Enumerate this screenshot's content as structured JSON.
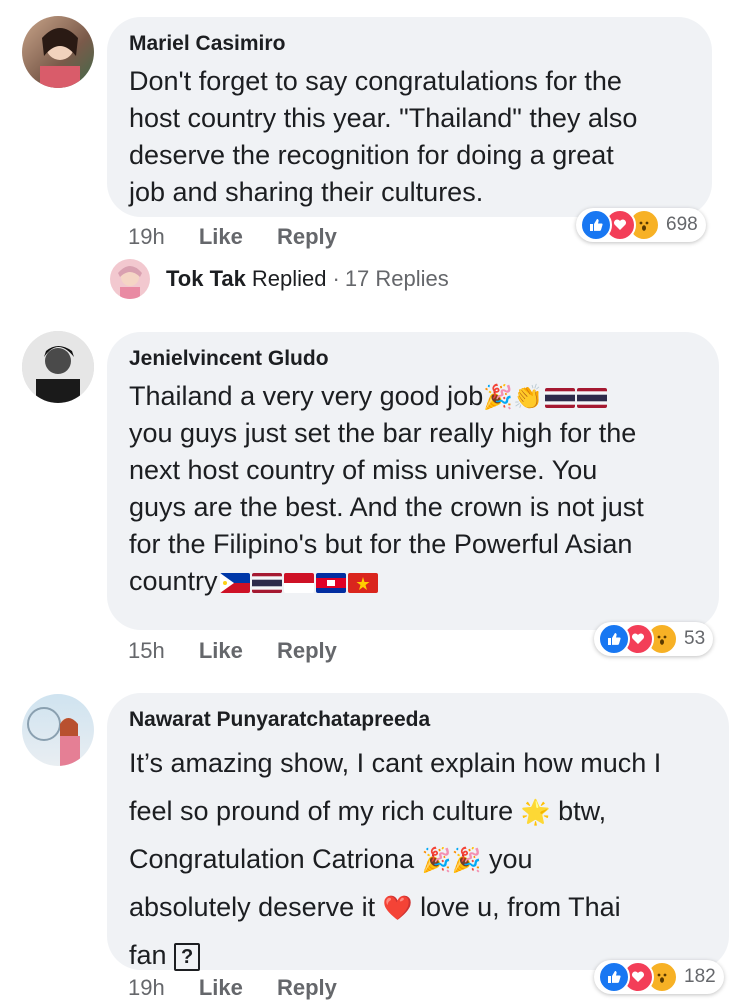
{
  "comments": [
    {
      "author": "Mariel Casimiro",
      "lines": [
        "Don't forget to say congratulations for the",
        "host country this year. \"Thailand\" they also",
        "deserve the recognition for doing a great",
        "job and sharing their cultures."
      ],
      "time": "19h",
      "like": "Like",
      "reply": "Reply",
      "reaction_count": "698",
      "replies": {
        "name": "Tok Tak",
        "verb": "Replied",
        "sep": "·",
        "count": "17 Replies"
      }
    },
    {
      "author": "Jenielvincent Gludo",
      "lines": [
        "Thailand a very very good job",
        "you guys just set the bar really high for the",
        "next host country of miss universe. You",
        "guys are the best. And the crown is not just",
        "for the Filipino's but for the Powerful Asian",
        "country"
      ],
      "time": "15h",
      "like": "Like",
      "reply": "Reply",
      "reaction_count": "53"
    },
    {
      "author": "Nawarat Punyaratchatapreeda",
      "lines": [
        "It’s amazing show, I cant explain how much I",
        "feel so pround of my rich culture",
        "btw,",
        "Congratulation Catriona",
        "you",
        "absolutely deserve it",
        "love u, from Thai",
        "fan"
      ],
      "time": "19h",
      "like": "Like",
      "reply": "Reply",
      "reaction_count": "182"
    }
  ],
  "icons": {
    "like": "like-reaction-icon",
    "love": "love-reaction-icon",
    "wow": "wow-reaction-icon",
    "party": "party-popper-icon",
    "clap": "clapping-hands-icon",
    "star": "glowing-star-icon",
    "heart": "red-heart-icon",
    "unknown": "?"
  },
  "colors": {
    "bubble": "#f0f2f5",
    "like": "#1877f2",
    "love": "#f33e58",
    "wow": "#f7b125",
    "meta": "#65676b"
  }
}
